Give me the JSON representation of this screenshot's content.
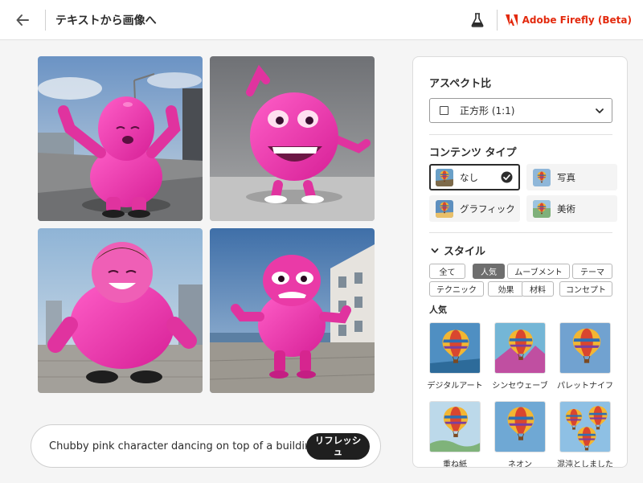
{
  "header": {
    "title": "テキストから画像へ",
    "brand": "Adobe Firefly (Beta)",
    "accent_color": "#e32a0e"
  },
  "icons": {
    "back": "arrow-left-icon",
    "labs": "flask-icon",
    "brand": "adobe-logo-icon"
  },
  "gallery": {
    "images": [
      {
        "subject": "pink-character-rooftop-1"
      },
      {
        "subject": "pink-character-ball-2"
      },
      {
        "subject": "pink-character-smiling-3"
      },
      {
        "subject": "pink-character-balcony-4"
      }
    ]
  },
  "prompt": {
    "text": "Chubby pink character dancing on top of a building",
    "refresh_label": "リフレッシュ"
  },
  "panel": {
    "aspect": {
      "title": "アスペクト比",
      "value": "正方形 (1:1)"
    },
    "content_type": {
      "title": "コンテンツ タイプ",
      "options": [
        {
          "label": "なし",
          "selected": true
        },
        {
          "label": "写真",
          "selected": false
        },
        {
          "label": "グラフィック",
          "selected": false
        },
        {
          "label": "美術",
          "selected": false
        }
      ]
    },
    "style": {
      "title": "スタイル",
      "tags": [
        {
          "label": "全て",
          "active": false
        },
        {
          "label": "人気",
          "active": true
        },
        {
          "label": "ムーブメント",
          "active": false
        },
        {
          "label": "テーマ",
          "active": false
        },
        {
          "label": "テクニック",
          "active": false
        },
        {
          "label": "効果",
          "active": false
        },
        {
          "label": "材料",
          "active": false
        },
        {
          "label": "コンセプト",
          "active": false
        }
      ],
      "popular_title": "人気",
      "items": [
        {
          "label": "デジタルアート"
        },
        {
          "label": "シンセウェーブ"
        },
        {
          "label": "パレットナイフ"
        },
        {
          "label": "重ね紙"
        },
        {
          "label": "ネオン"
        },
        {
          "label": "混沌としました"
        }
      ]
    }
  }
}
